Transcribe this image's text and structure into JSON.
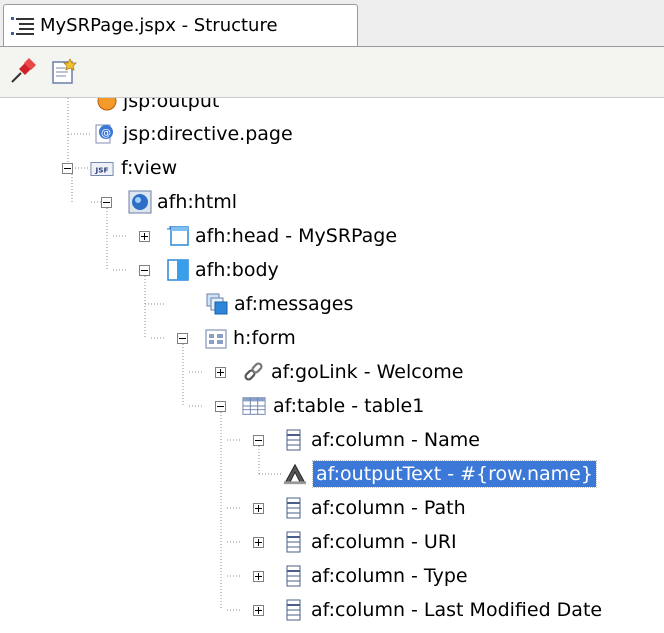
{
  "tab": {
    "title": "MySRPage.jspx - Structure",
    "icon": "structure-icon"
  },
  "toolbar": {
    "buttons": [
      {
        "icon": "pin-icon"
      },
      {
        "icon": "edit-properties-icon"
      }
    ]
  },
  "tree": {
    "nodes": [
      {
        "label": "jsp:output",
        "icon": "jsp-output-icon"
      },
      {
        "label": "jsp:directive.page",
        "icon": "directive-icon"
      },
      {
        "label": "f:view",
        "icon": "jsf-icon"
      },
      {
        "label": "afh:html",
        "icon": "globe-icon"
      },
      {
        "label": "afh:head - MySRPage",
        "icon": "head-icon"
      },
      {
        "label": "afh:body",
        "icon": "body-icon"
      },
      {
        "label": "af:messages",
        "icon": "messages-icon"
      },
      {
        "label": "h:form",
        "icon": "form-icon"
      },
      {
        "label": "af:goLink - Welcome",
        "icon": "link-icon"
      },
      {
        "label": "af:table - table1",
        "icon": "table-icon"
      },
      {
        "label": "af:column - Name",
        "icon": "column-icon"
      },
      {
        "label": "af:outputText - #{row.name}",
        "icon": "output-text-icon",
        "selected": true
      },
      {
        "label": "af:column - Path",
        "icon": "column-icon"
      },
      {
        "label": "af:column - URI",
        "icon": "column-icon"
      },
      {
        "label": "af:column - Type",
        "icon": "column-icon"
      },
      {
        "label": "af:column - Last Modified Date",
        "icon": "column-icon"
      }
    ]
  }
}
